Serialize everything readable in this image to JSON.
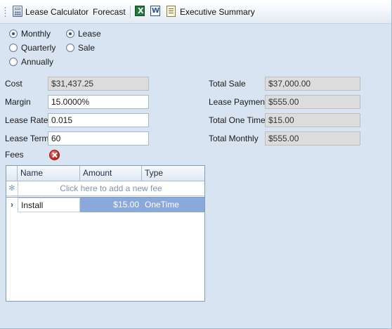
{
  "toolbar": {
    "lease_calculator_label": "Lease Calculator",
    "forecast_label": "Forecast",
    "executive_summary_label": "Executive Summary"
  },
  "frequency": {
    "options": [
      "Monthly",
      "Quarterly",
      "Annually"
    ],
    "selected": "Monthly"
  },
  "deal_type": {
    "options": [
      "Lease",
      "Sale"
    ],
    "selected": "Lease"
  },
  "form": {
    "cost_label": "Cost",
    "cost_value": "$31,437.25",
    "margin_label": "Margin",
    "margin_value": "15.0000%",
    "lease_rate_label": "Lease Rate",
    "lease_rate_value": "0.015",
    "lease_term_label": "Lease Term",
    "lease_term_value": "60",
    "fees_label": "Fees"
  },
  "totals": {
    "total_sale_label": "Total Sale",
    "total_sale_value": "$37,000.00",
    "lease_payment_label": "Lease Payment",
    "lease_payment_value": "$555.00",
    "total_one_time_label": "Total One Time",
    "total_one_time_value": "$15.00",
    "total_monthly_label": "Total Monthly",
    "total_monthly_value": "$555.00"
  },
  "fees_grid": {
    "columns": [
      "Name",
      "Amount",
      "Type"
    ],
    "new_row_text": "Click here to add a new fee",
    "rows": [
      {
        "name": "Install",
        "amount": "$15.00",
        "type": "OneTime"
      }
    ]
  },
  "colors": {
    "background": "#d8e4f2",
    "selection": "#8aa8d9",
    "readonly_field": "#dcdcdc"
  }
}
